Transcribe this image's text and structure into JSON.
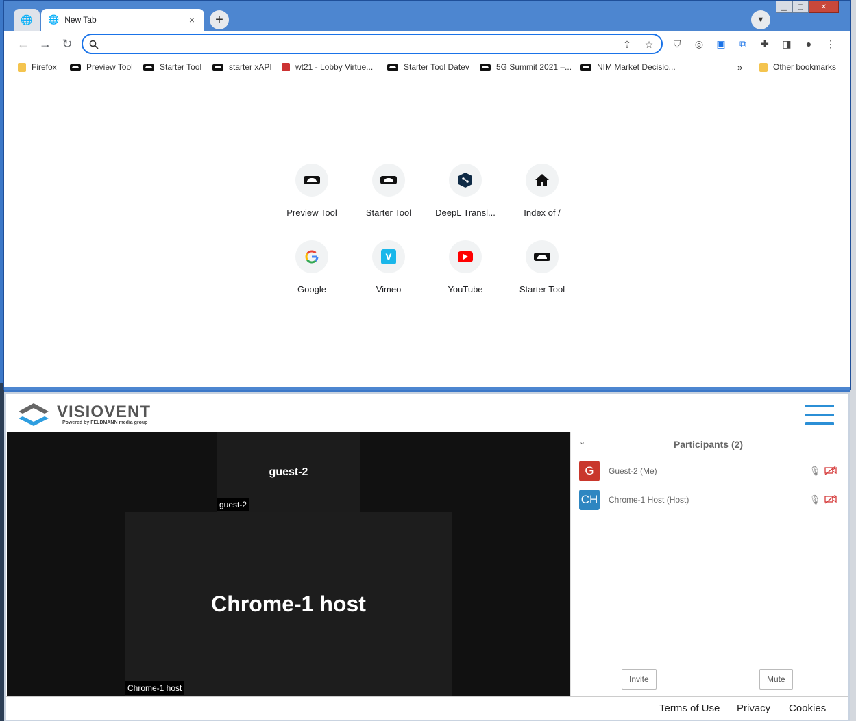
{
  "browser": {
    "tab_title": "New Tab",
    "tab_close": "×",
    "new_tab": "+",
    "omnibox": {
      "value": "",
      "placeholder": ""
    },
    "bookmarks": [
      {
        "label": "Firefox",
        "icon": "folder"
      },
      {
        "label": "Preview Tool",
        "icon": "mask"
      },
      {
        "label": "Starter Tool",
        "icon": "mask"
      },
      {
        "label": "starter xAPI",
        "icon": "mask"
      },
      {
        "label": "wt21 - Lobby Virtue...",
        "icon": "wt"
      },
      {
        "label": "Starter Tool Datev",
        "icon": "mask"
      },
      {
        "label": "5G Summit 2021 –...",
        "icon": "mask"
      },
      {
        "label": "NIM Market Decisio...",
        "icon": "mask"
      }
    ],
    "bookmarks_overflow": "»",
    "other_bookmarks": "Other bookmarks",
    "shortcuts": [
      {
        "label": "Preview Tool",
        "icon": "mask-icon"
      },
      {
        "label": "Starter Tool",
        "icon": "mask-icon"
      },
      {
        "label": "DeepL Transl...",
        "icon": "deepl-icon"
      },
      {
        "label": "Index of /",
        "icon": "home-icon"
      },
      {
        "label": "Google",
        "icon": "google-icon"
      },
      {
        "label": "Vimeo",
        "icon": "vimeo-icon"
      },
      {
        "label": "YouTube",
        "icon": "youtube-icon"
      },
      {
        "label": "Starter Tool",
        "icon": "mask-icon"
      }
    ]
  },
  "visiovent": {
    "brand": "VISIOVENT",
    "tagline": "Powered by FELDMANN media group",
    "stage": {
      "guest_name": "guest-2",
      "guest_tag": "guest-2",
      "host_name": "Chrome-1 host",
      "host_tag": "Chrome-1 host"
    },
    "participants": {
      "title": "Participants (2)",
      "items": [
        {
          "initials": "G",
          "name": "Guest-2  (Me)",
          "color": "#c9372c"
        },
        {
          "initials": "CH",
          "name": "Chrome-1 Host  (Host)",
          "color": "#2e86c1"
        }
      ],
      "invite_label": "Invite",
      "mute_label": "Mute"
    },
    "footer": {
      "terms": "Terms of Use",
      "privacy": "Privacy",
      "cookies": "Cookies"
    }
  }
}
